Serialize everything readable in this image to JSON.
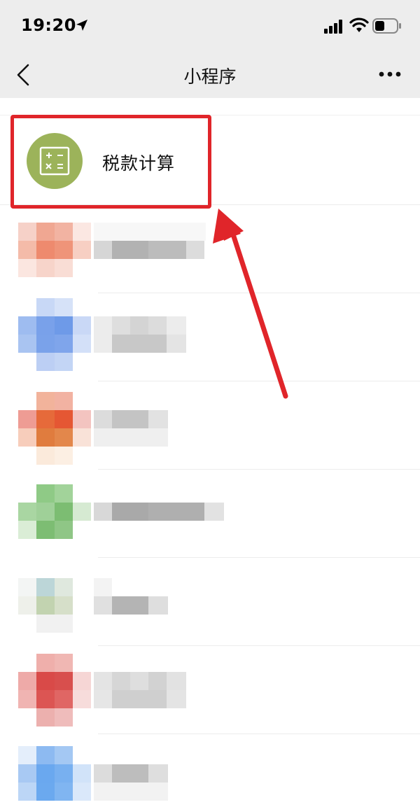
{
  "status_bar": {
    "time": "19:20",
    "icons": [
      "location-arrow-icon",
      "cellular-signal-icon",
      "wifi-icon",
      "battery-icon"
    ]
  },
  "nav": {
    "title": "小程序",
    "back_icon": "chevron-left-icon",
    "more_icon": "more-dots-icon"
  },
  "list": {
    "highlighted_item": {
      "name": "税款计算",
      "icon": "calculator-icon",
      "icon_color": "#9cb35a"
    },
    "blurred_items": [
      {
        "accent": "#ee8a6e"
      },
      {
        "accent": "#6e9ae8"
      },
      {
        "accent": "#e66a3a"
      },
      {
        "accent": "#7cbd72"
      },
      {
        "accent": "#c2d3b0"
      },
      {
        "accent": "#d94a48"
      },
      {
        "accent": "#6aa8ef"
      }
    ]
  },
  "annotation": {
    "box_color": "#e0252a",
    "arrow_color": "#e0252a"
  }
}
